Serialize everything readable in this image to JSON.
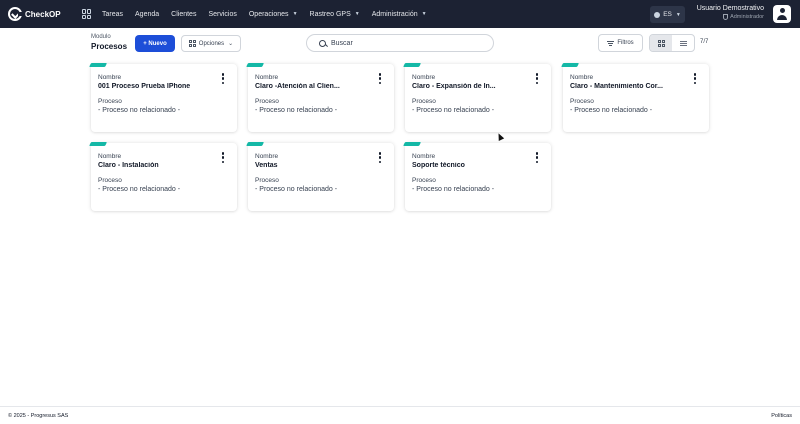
{
  "app": {
    "logo_text": "CheckOP"
  },
  "nav": {
    "items": [
      {
        "label": "Tareas",
        "has_caret": false
      },
      {
        "label": "Agenda",
        "has_caret": false
      },
      {
        "label": "Clientes",
        "has_caret": false
      },
      {
        "label": "Servicios",
        "has_caret": false
      },
      {
        "label": "Operaciones",
        "has_caret": true
      },
      {
        "label": "Rastreo GPS",
        "has_caret": true
      },
      {
        "label": "Administración",
        "has_caret": true
      }
    ],
    "language": "ES",
    "user_name": "Usuario Demostrativo",
    "user_role": "Administrador"
  },
  "toolbar": {
    "module_label": "Modulo",
    "module_title": "Procesos",
    "new_button": "+ Nuevo",
    "options_button": "Opciones",
    "search_placeholder": "Buscar",
    "filters_button": "Filtros",
    "counter": "7/7"
  },
  "cards": [
    {
      "name_label": "Nombre",
      "name": "001 Proceso Prueba IPhone",
      "process_label": "Proceso",
      "process": "- Proceso no relacionado -"
    },
    {
      "name_label": "Nombre",
      "name": "Claro -Atención al Clien...",
      "process_label": "Proceso",
      "process": "- Proceso no relacionado -"
    },
    {
      "name_label": "Nombre",
      "name": "Claro - Expansión de In...",
      "process_label": "Proceso",
      "process": "- Proceso no relacionado -"
    },
    {
      "name_label": "Nombre",
      "name": "Claro - Mantenimiento Cor...",
      "process_label": "Proceso",
      "process": "- Proceso no relacionado -"
    },
    {
      "name_label": "Nombre",
      "name": "Claro - Instalación",
      "process_label": "Proceso",
      "process": "- Proceso no relacionado -"
    },
    {
      "name_label": "Nombre",
      "name": "Ventas",
      "process_label": "Proceso",
      "process": "- Proceso no relacionado -"
    },
    {
      "name_label": "Nombre",
      "name": "Soporte técnico",
      "process_label": "Proceso",
      "process": "- Proceso no relacionado -"
    }
  ],
  "footer": {
    "copyright": "© 2025 - Progresus SAS",
    "policies": "Políticas"
  },
  "colors": {
    "nav_bg": "#1c2233",
    "primary": "#1d4ed8",
    "card_accent": "#14b8a6"
  }
}
